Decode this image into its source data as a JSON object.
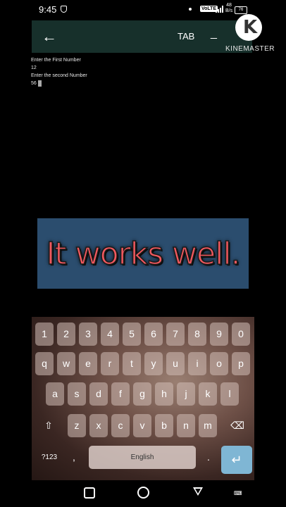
{
  "status": {
    "time": "9:45",
    "volte": "VoLTE",
    "speed_top": "48",
    "speed_bottom": "B/s",
    "battery": "76"
  },
  "appbar": {
    "back_icon": "arrow-left-icon",
    "title": "TAB",
    "minimize": "_"
  },
  "watermark": {
    "letter": "K",
    "text": "KINEMASTER"
  },
  "terminal": {
    "lines": [
      "Enter the First Number",
      "12",
      "Enter the second Number",
      "56"
    ]
  },
  "banner": {
    "text": "It works well."
  },
  "keyboard": {
    "row_numbers": [
      "1",
      "2",
      "3",
      "4",
      "5",
      "6",
      "7",
      "8",
      "9",
      "0"
    ],
    "row_top": [
      "q",
      "w",
      "e",
      "r",
      "t",
      "y",
      "u",
      "i",
      "o",
      "p"
    ],
    "row_mid": [
      "a",
      "s",
      "d",
      "f",
      "g",
      "h",
      "j",
      "k",
      "l"
    ],
    "row_bottom": [
      "z",
      "x",
      "c",
      "v",
      "b",
      "n",
      "m"
    ],
    "shift_icon": "shift-icon",
    "backspace_icon": "backspace-icon",
    "symbols_label": "?123",
    "comma_label": ",",
    "space_label": "English",
    "period_label": ".",
    "enter_icon": "enter-icon"
  },
  "navbar": {
    "recents_icon": "square-icon",
    "home_icon": "circle-icon",
    "back_icon": "triangle-icon",
    "keyboard_icon": "keyboard-icon"
  }
}
